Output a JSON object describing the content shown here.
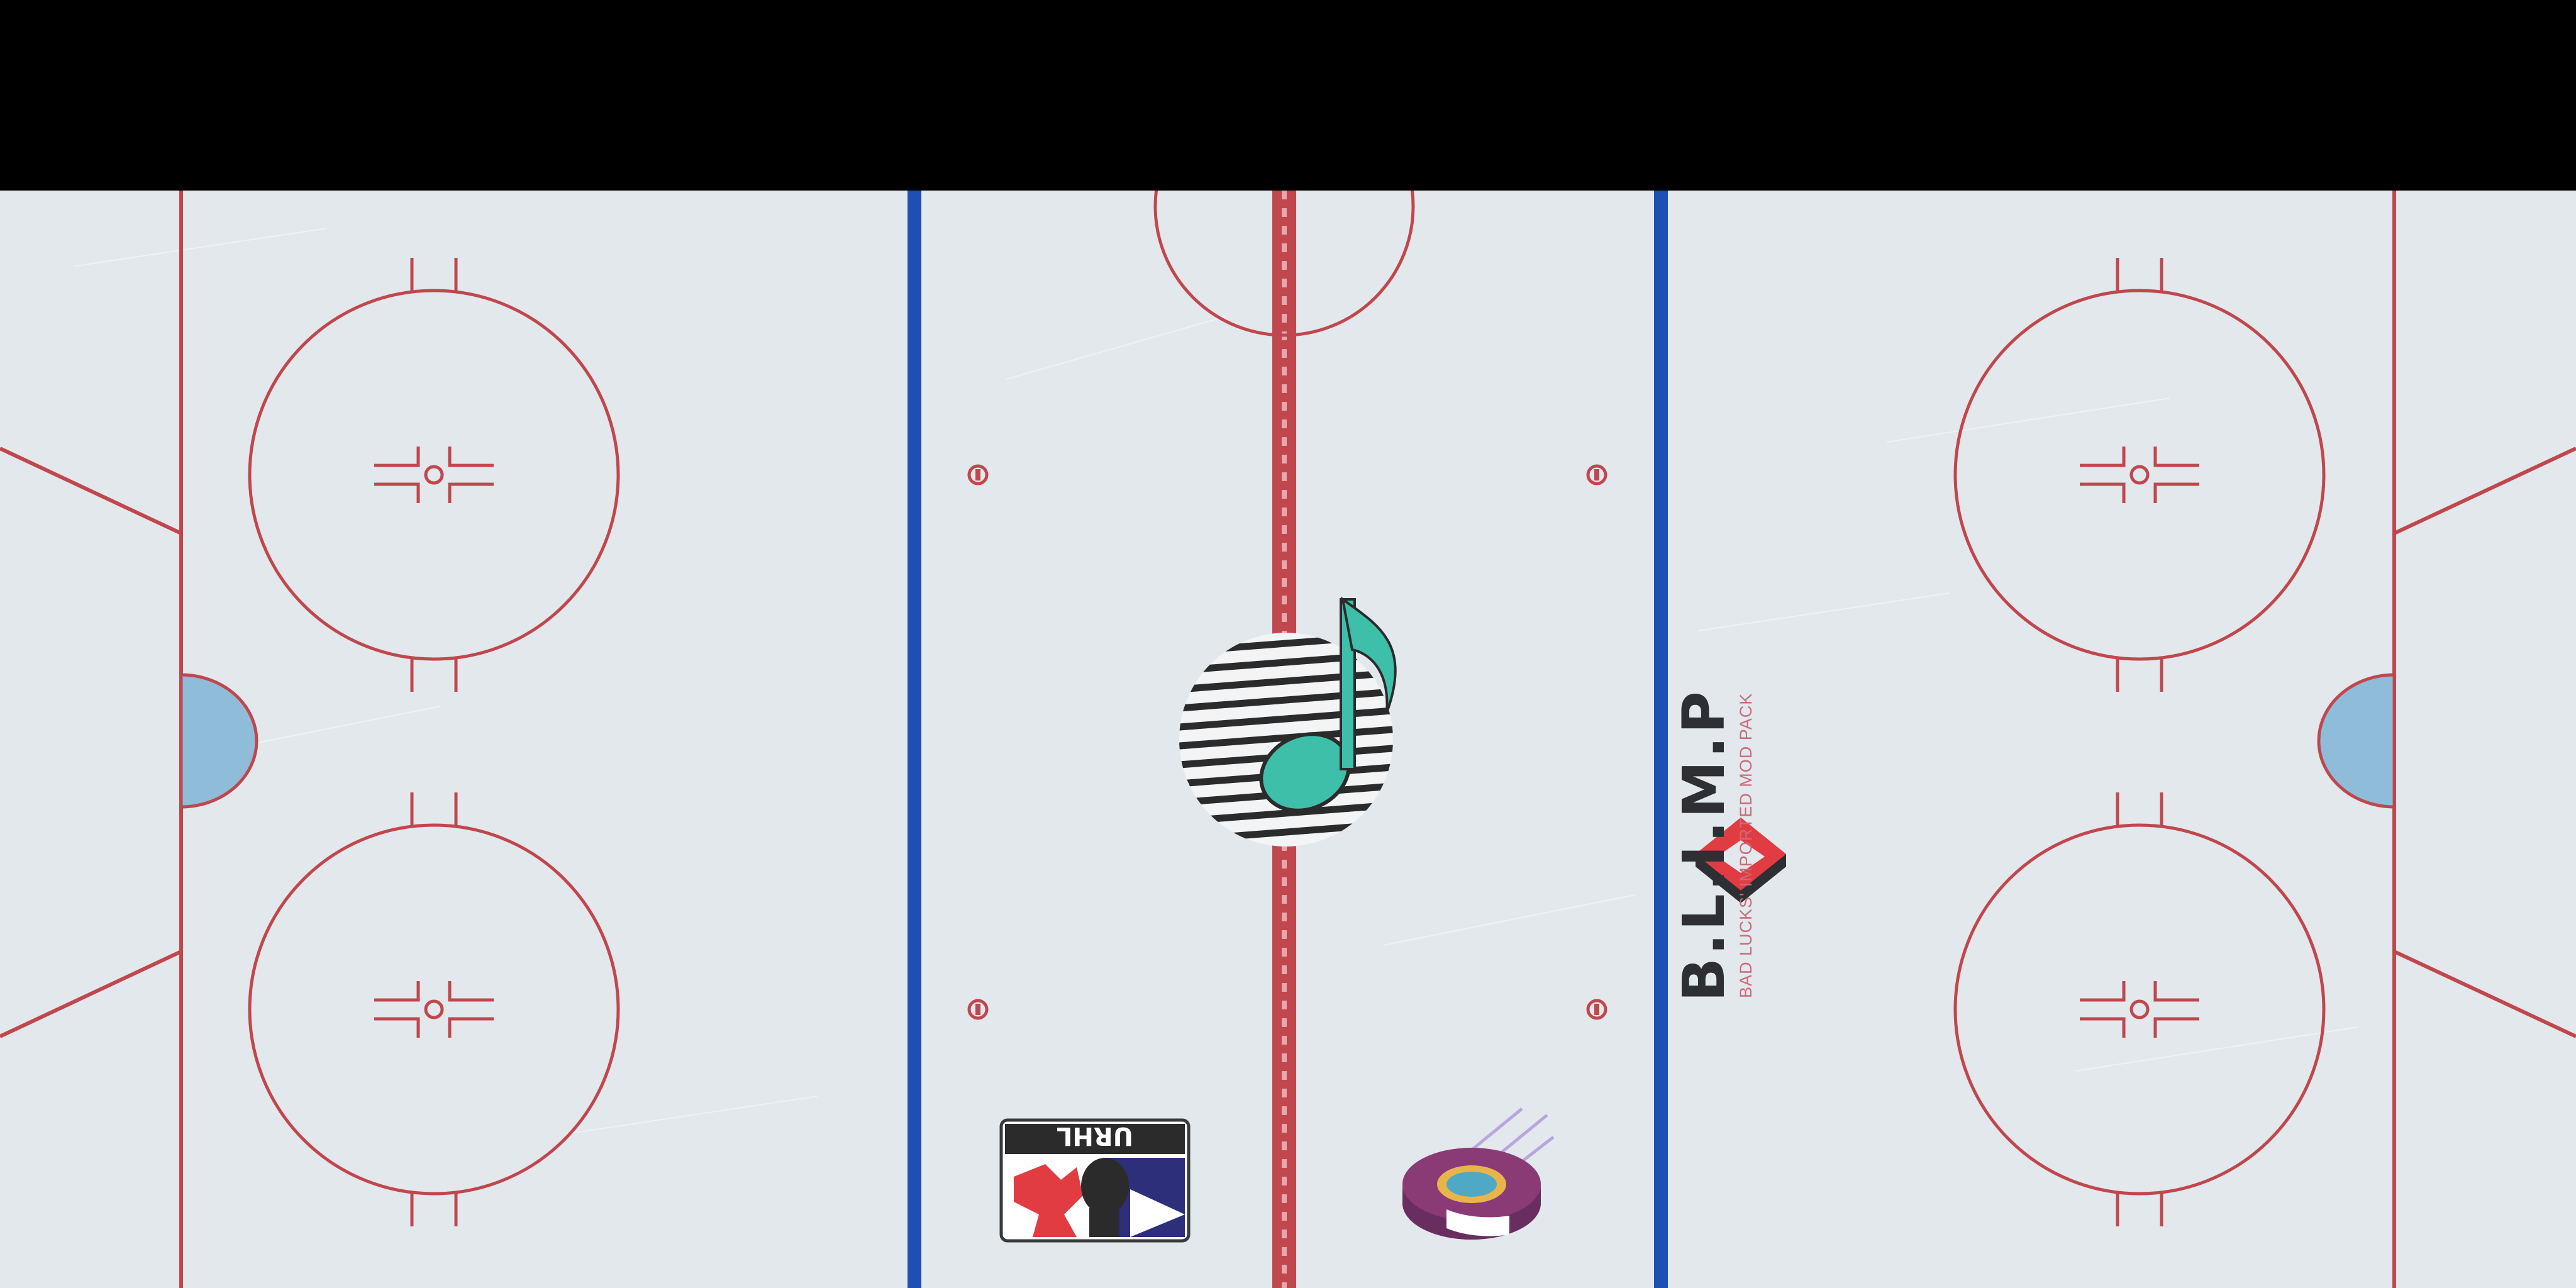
{
  "scene": {
    "type": "hockey-rink-ice-texture",
    "colors": {
      "background": "#000000",
      "ice": "#e2e8ec",
      "red_line": "#c0474d",
      "blue_line": "#1e4fb3",
      "crease": "#8fbcd9"
    }
  },
  "logos": {
    "music_note": {
      "icon": "music-note-icon",
      "colors": [
        "#3dbfa9",
        "#2b2b2b"
      ]
    },
    "blimp": {
      "title": "B.L.I.M.P",
      "subtitle": "BAD LUCKS' IMPORTED MOD PACK",
      "icon": "diamond-icon",
      "colors": [
        "#e23c43",
        "#2d2f33"
      ]
    },
    "urhl": {
      "text": "URHL",
      "icon": "league-shield-icon",
      "colors": [
        "#e23c43",
        "#2e2f7a",
        "#2b2b2b"
      ]
    },
    "puck": {
      "icon": "puck-icon",
      "colors": [
        "#8a3a75",
        "#e9b54a",
        "#4fa9c4"
      ]
    }
  }
}
